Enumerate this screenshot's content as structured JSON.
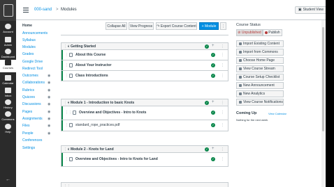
{
  "global_nav": {
    "items": [
      {
        "label": "Account",
        "icon": "account-icon"
      },
      {
        "label": "Admin",
        "icon": "admin-icon"
      },
      {
        "label": "Dashboard",
        "icon": "dashboard-icon"
      },
      {
        "label": "Courses",
        "icon": "courses-icon"
      },
      {
        "label": "Calendar",
        "icon": "calendar-icon"
      },
      {
        "label": "Inbox",
        "icon": "inbox-icon"
      },
      {
        "label": "History",
        "icon": "history-icon"
      },
      {
        "label": "Commons",
        "icon": "commons-icon"
      },
      {
        "label": "Help",
        "icon": "help-icon"
      }
    ]
  },
  "header": {
    "course": "000-sand",
    "separator": ">",
    "page": "Modules",
    "student_view": "Student View"
  },
  "course_nav": [
    "Home",
    "Announcements",
    "Syllabus",
    "Modules",
    "Grades",
    "Google Drive",
    "Redirect Tool",
    "Outcomes",
    "Collaborations",
    "Rubrics",
    "Quizzes",
    "Discussions",
    "Pages",
    "Assignments",
    "Files",
    "People",
    "Conferences",
    "Settings"
  ],
  "toolbar": {
    "collapse_all": "Collapse All",
    "view_progress": "View Progress",
    "export": "Export Course Content",
    "add_module": "+ Module"
  },
  "modules": [
    {
      "title": "Getting Started",
      "items": [
        {
          "title": "About this Course",
          "bold": true
        },
        {
          "title": "About Your Instructor",
          "bold": true
        },
        {
          "title": "Class Introductions",
          "bold": true
        }
      ]
    },
    {
      "title": "Module 1 - Introduction to basic Knots",
      "items": [
        {
          "title": "Overview and Objectives - Intro to Knots",
          "bold": true
        },
        {
          "title": "standard_rope_practices.pdf",
          "bold": false
        }
      ]
    },
    {
      "title": "Module 2 - Knots for Land",
      "items": [
        {
          "title": "Overview and Objectives - Intro to Knots for Land",
          "bold": true
        }
      ]
    }
  ],
  "sidebar": {
    "status_title": "Course Status",
    "unpublished": "Unpublished",
    "publish": "Publish",
    "buttons": [
      "Import Existing Content",
      "Import from Commons",
      "Choose Home Page",
      "View Course Stream",
      "Course Setup Checklist",
      "New Announcement",
      "New Analytics",
      "View Course Notifications"
    ],
    "coming_up": "Coming Up",
    "view_calendar": "View Calendar",
    "nothing": "Nothing for the next week"
  },
  "colors": {
    "published": "#0b874b",
    "link": "#008ee2",
    "nav_bg": "#2b2b2b"
  }
}
